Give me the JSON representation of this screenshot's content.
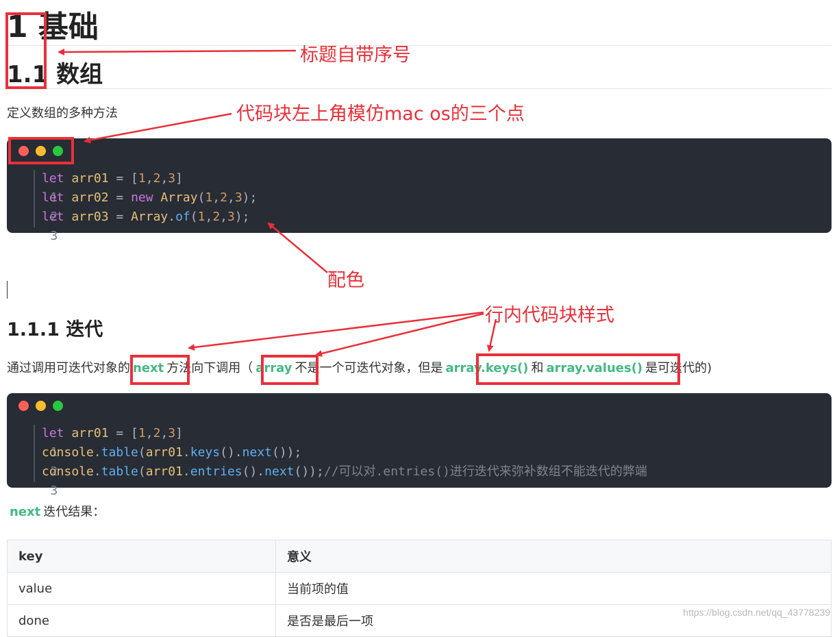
{
  "heading1": "1 基础",
  "heading2": "1.1 数组",
  "para_define": "定义数组的多种方法",
  "code1": {
    "line_numbers": [
      "1",
      "2",
      "3"
    ]
  },
  "heading3": "1.1.1 迭代",
  "para_iter": {
    "before_next": "通过调用可迭代对象的",
    "code_next": "next",
    "after_next": "方法向下调用（",
    "code_array": "array",
    "after_array": "不是一个可迭代对象，但是",
    "code_keys": "array.keys()",
    "and": "和",
    "code_values": "array.values()",
    "end": "是可迭代的)"
  },
  "code2": {
    "line_numbers": [
      "1",
      "2",
      "3"
    ],
    "comment": "//可以对.entries()进行迭代来弥补数组不能迭代的弊端"
  },
  "next_result": {
    "code": "next",
    "text": "迭代结果："
  },
  "table": {
    "headers": [
      "key",
      "意义"
    ],
    "rows": [
      [
        "value",
        "当前项的值"
      ],
      [
        "done",
        "是否是最后一项"
      ]
    ]
  },
  "watermark": "https://blog.csdn.net/qq_43778239",
  "annotations": {
    "heading_number": "标题自带序号",
    "mac_dots": "代码块左上角模仿mac os的三个点",
    "colors": "配色",
    "inline_code": "行内代码块样式"
  },
  "colors": {
    "code_bg": "#282c34",
    "inline_code": "#42b983",
    "annotation": "#e8303a"
  }
}
